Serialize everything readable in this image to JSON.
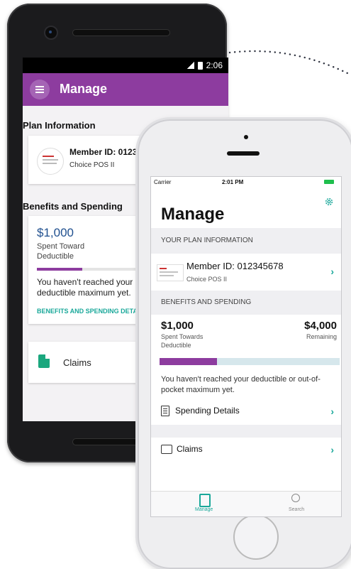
{
  "colors": {
    "purple": "#8d3c9f",
    "teal": "#1aa89a",
    "green": "#1ba77e"
  },
  "android": {
    "status_time": "2:06",
    "title": "Manage",
    "plan_section": "Plan Information",
    "member_id": "Member ID: 012345678",
    "plan_name": "Choice POS II",
    "benefits_section": "Benefits and Spending",
    "amount": "$1,000",
    "spent_label": "Spent Toward",
    "deductible_label": "Deductible",
    "progress_fraction": 0.32,
    "message": "You haven't reached your deductible maximum yet.",
    "details_link": "BENEFITS AND SPENDING DETAILS",
    "claims_label": "Claims"
  },
  "iphone": {
    "carrier": "Carrier",
    "status_time": "2:01 PM",
    "title": "Manage",
    "plan_band": "YOUR PLAN INFORMATION",
    "member_id": "Member ID: 012345678",
    "plan_name": "Choice POS II",
    "benefits_band": "BENEFITS AND SPENDING",
    "spent_amount": "$1,000",
    "spent_label": "Spent Towards",
    "deductible_label": "Deductible",
    "remaining_amount": "$4,000",
    "remaining_label": "Remaining",
    "progress_fraction": 0.32,
    "message": "You haven't reached your deductible or out-of-pocket maximum yet.",
    "spending_details": "Spending Details",
    "claims_label": "Claims",
    "chevron": "›",
    "tabs": [
      {
        "label": "Manage",
        "icon": "manage-tab-icon"
      },
      {
        "label": "Search",
        "icon": "search-tab-icon"
      }
    ]
  }
}
